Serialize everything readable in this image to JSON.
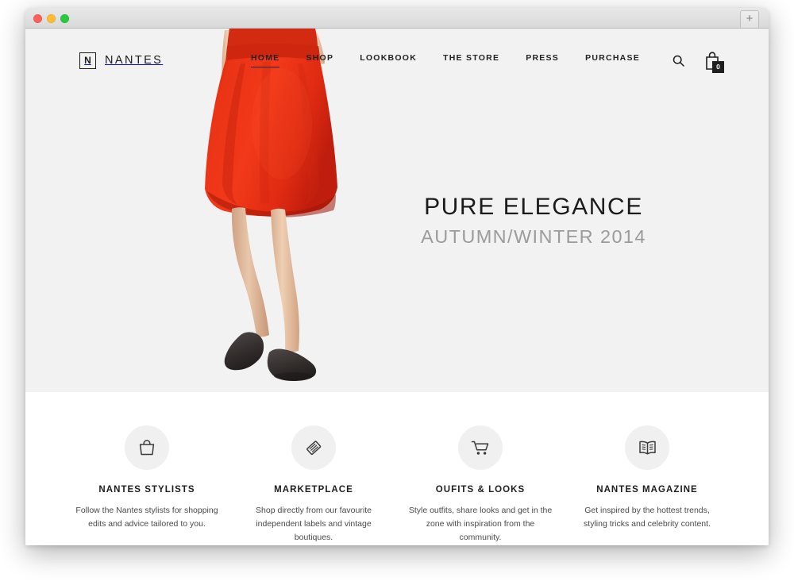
{
  "browser": {
    "traffic_lights": [
      "close",
      "minimize",
      "maximize"
    ],
    "new_tab_label": "+"
  },
  "site": {
    "brand": {
      "mark_letter": "N",
      "name": "NANTES"
    },
    "nav": {
      "items": [
        {
          "label": "HOME",
          "active": true
        },
        {
          "label": "SHOP",
          "active": false
        },
        {
          "label": "LOOKBOOK",
          "active": false
        },
        {
          "label": "THE STORE",
          "active": false
        },
        {
          "label": "PRESS",
          "active": false
        },
        {
          "label": "PURCHASE",
          "active": false
        }
      ],
      "search_icon": "search-icon",
      "cart_icon": "shopping-bag-icon",
      "cart_count": "0"
    },
    "hero": {
      "title": "PURE ELEGANCE",
      "subtitle": "AUTUMN/WINTER 2014",
      "background_color": "#f2f2f2",
      "image_alt": "woman-in-red-skirt"
    },
    "features": [
      {
        "icon": "handbag-icon",
        "title": "NANTES STYLISTS",
        "description": "Follow the Nantes stylists for shopping edits and advice tailored to you."
      },
      {
        "icon": "price-tag-icon",
        "title": "MARKETPLACE",
        "description": "Shop directly from our favourite independent labels and vintage boutiques."
      },
      {
        "icon": "shopping-cart-icon",
        "title": "OUFITS & LOOKS",
        "description": "Style outfits, share looks and get in the zone with inspiration from the community."
      },
      {
        "icon": "open-book-icon",
        "title": "NANTES MAGAZINE",
        "description": "Get inspired by the hottest trends, styling tricks and celebrity content."
      }
    ],
    "colors": {
      "accent_red": "#e8311a",
      "text_dark": "#1b1b1b",
      "text_muted": "#9b9b9b",
      "hero_bg": "#f2f2f2",
      "icon_circle_bg": "#f0f0f0"
    }
  }
}
